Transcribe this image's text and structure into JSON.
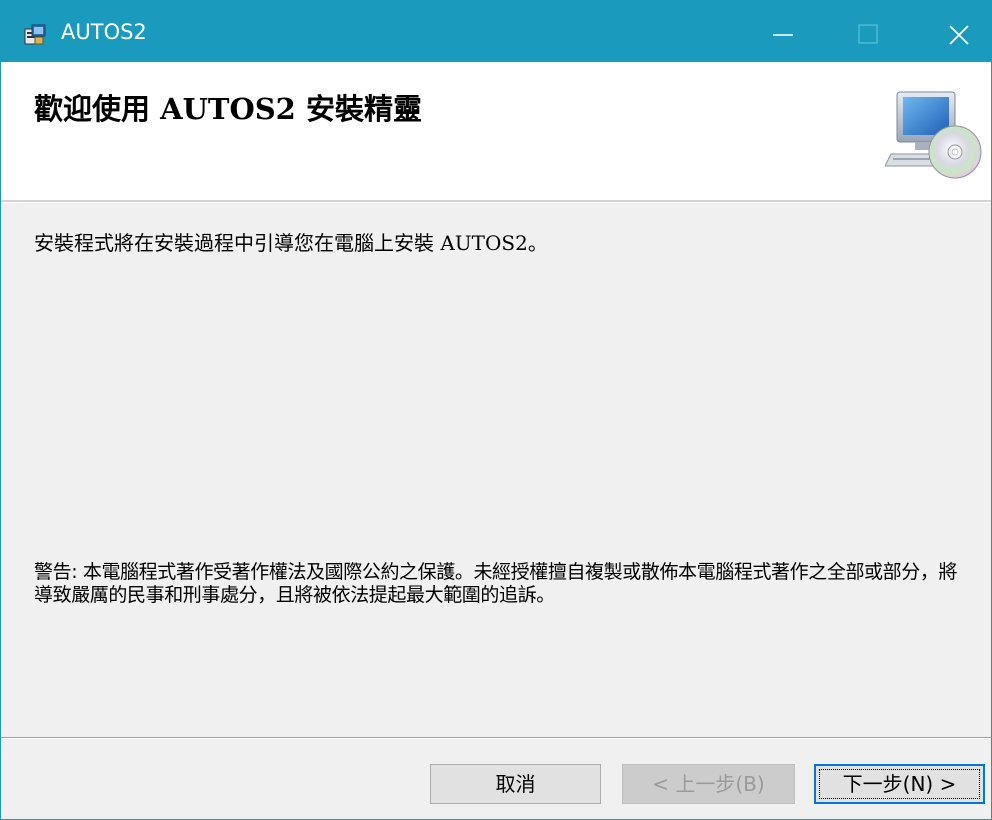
{
  "window": {
    "title": "AUTOS2",
    "title_bar_color": "#1a9bbd"
  },
  "banner": {
    "title": "歡迎使用 AUTOS2 安裝精靈",
    "image_icon": "computer-cd-icon"
  },
  "body": {
    "intro": "安裝程式將在安裝過程中引導您在電腦上安裝 AUTOS2。",
    "warning": "警告: 本電腦程式著作受著作權法及國際公約之保護。未經授權擅自複製或散佈本電腦程式著作之全部或部分，將導致嚴厲的民事和刑事處分，且將被依法提起最大範圍的追訴。"
  },
  "buttons": {
    "cancel": "取消",
    "back": "< 上一步(B)",
    "next": "下一步(N) >"
  },
  "icons": {
    "app": "installer-icon",
    "minimize": "minimize-icon",
    "maximize": "maximize-icon",
    "close": "close-icon"
  }
}
